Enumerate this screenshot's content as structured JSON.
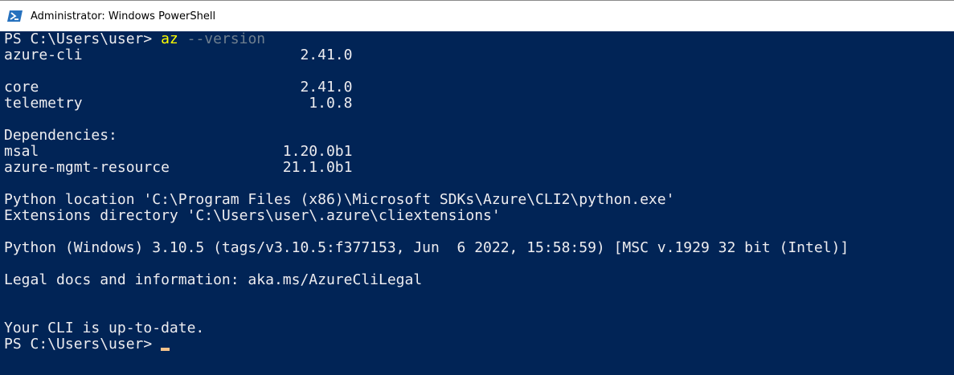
{
  "window": {
    "title": "Administrator: Windows PowerShell",
    "icon": "powershell-icon"
  },
  "colors": {
    "console_bg": "#012456",
    "console_text": "#eeedf0",
    "command": "#ffff00",
    "parameter": "#6f7f8f",
    "cursor": "#f4c28b"
  },
  "console": {
    "prompt1": "PS C:\\Users\\user> ",
    "command": "az",
    "argument": "--version",
    "lines": [
      "azure-cli                         2.41.0",
      "",
      "core                              2.41.0",
      "telemetry                          1.0.8",
      "",
      "Dependencies:",
      "msal                            1.20.0b1",
      "azure-mgmt-resource             21.1.0b1",
      "",
      "Python location 'C:\\Program Files (x86)\\Microsoft SDKs\\Azure\\CLI2\\python.exe'",
      "Extensions directory 'C:\\Users\\user\\.azure\\cliextensions'",
      "",
      "Python (Windows) 3.10.5 (tags/v3.10.5:f377153, Jun  6 2022, 15:58:59) [MSC v.1929 32 bit (Intel)]",
      "",
      "Legal docs and information: aka.ms/AzureCliLegal",
      "",
      "",
      "Your CLI is up-to-date."
    ],
    "prompt2": "PS C:\\Users\\user> "
  }
}
